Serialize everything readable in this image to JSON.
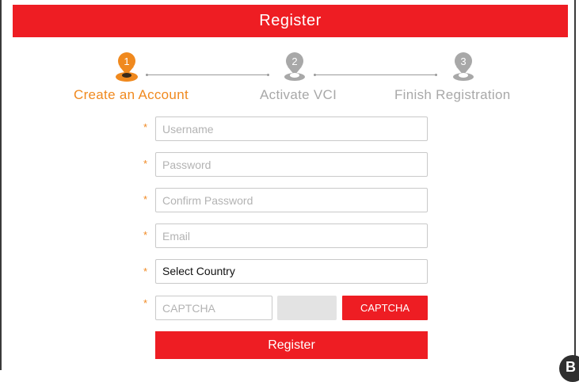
{
  "header": {
    "title": "Register"
  },
  "steps": [
    {
      "number": "1",
      "label": "Create an Account",
      "state": "active"
    },
    {
      "number": "2",
      "label": "Activate VCI",
      "state": "inactive"
    },
    {
      "number": "3",
      "label": "Finish Registration",
      "state": "inactive"
    }
  ],
  "form": {
    "required_mark": "*",
    "username": {
      "placeholder": "Username",
      "value": ""
    },
    "password": {
      "placeholder": "Password",
      "value": ""
    },
    "confirm_password": {
      "placeholder": "Confirm Password",
      "value": ""
    },
    "email": {
      "placeholder": "Email",
      "value": ""
    },
    "country": {
      "selected": "Select Country"
    },
    "captcha": {
      "placeholder": "CAPTCHA",
      "value": "",
      "button_label": "CAPTCHA"
    },
    "submit_label": "Register"
  },
  "corner_badge": {
    "label": "B"
  },
  "colors": {
    "brand_red": "#ee1d23",
    "accent_orange": "#f0891e",
    "inactive_gray": "#a8a8a8"
  }
}
